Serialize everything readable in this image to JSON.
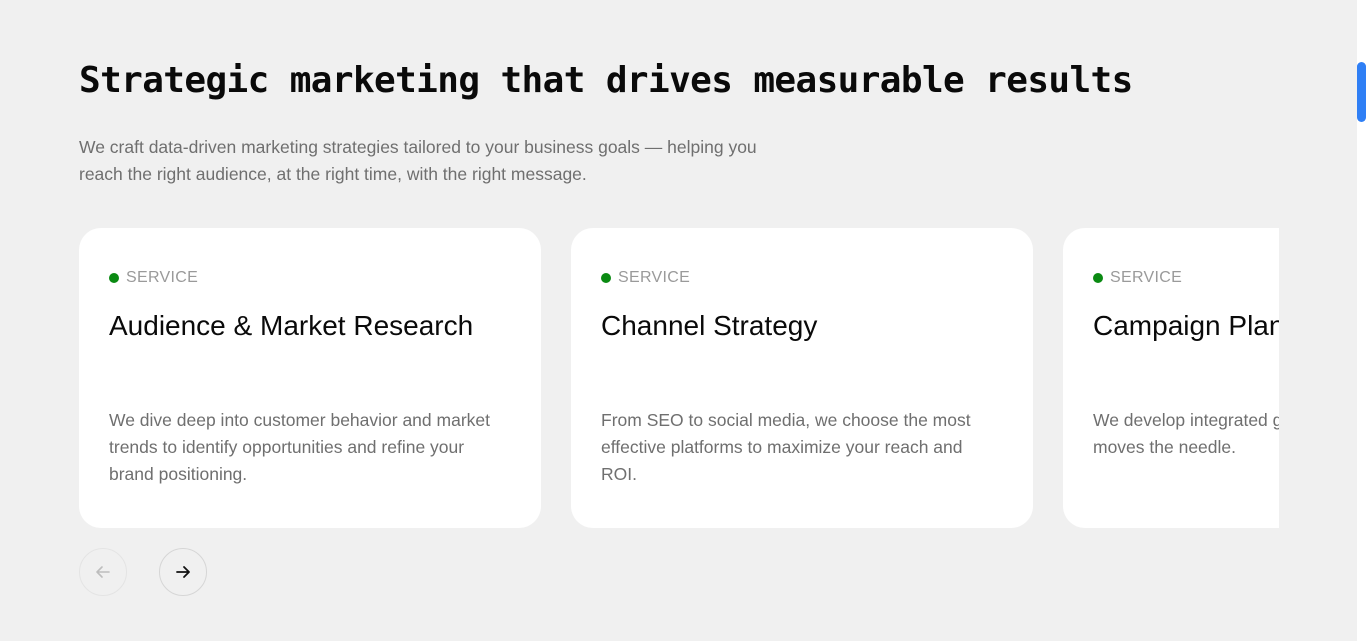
{
  "section": {
    "title": "Strategic marketing that drives measurable results",
    "subtitle": "We craft data-driven marketing strategies tailored to your business goals — helping you reach the right audience, at the right time, with the right message."
  },
  "cards": [
    {
      "tag": "SERVICE",
      "title": "Audience & Market Research",
      "description": "We dive deep into customer behavior and market trends to identify opportunities and refine your brand positioning."
    },
    {
      "tag": "SERVICE",
      "title": "Channel Strategy",
      "description": "From SEO to social media, we choose the most effective platforms to maximize your reach and ROI."
    },
    {
      "tag": "SERVICE",
      "title": "Campaign Plan",
      "description": "We develop integrated goals, timelines, and K moves the needle."
    }
  ],
  "navigation": {
    "prev_icon": "arrow-left-icon",
    "next_icon": "arrow-right-icon"
  },
  "colors": {
    "background": "#f0f0f0",
    "card": "#ffffff",
    "status_dot": "#0a8a12",
    "scroll_thumb": "#2f7ff5"
  }
}
